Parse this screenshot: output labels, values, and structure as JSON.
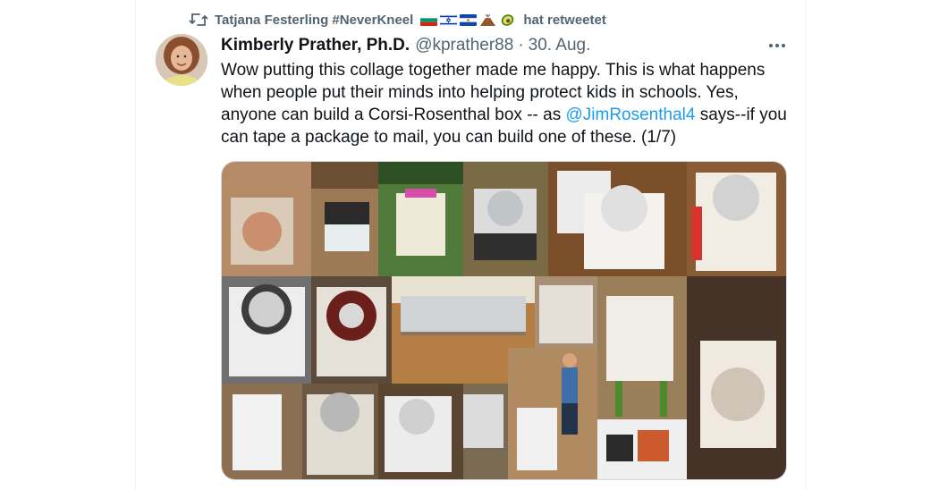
{
  "retweet": {
    "icon": "retweet-icon",
    "retweeter_name": "Tatjana Festerling #NeverKneel",
    "flags": [
      "bulgaria-flag",
      "israel-flag",
      "el-salvador-flag",
      "volcano-emoji",
      "avocado-emoji"
    ],
    "action_text": "hat retweetet"
  },
  "tweet": {
    "avatar_icon": "avatar-photo",
    "author_name": "Kimberly Prather, Ph.D.",
    "handle": "@kprather88",
    "separator": "·",
    "date": "30. Aug.",
    "more_icon": "more-options-icon",
    "text_part1": "Wow putting this collage together made me happy. This is what happens when people put their minds into helping protect kids in schools.  Yes, anyone can build a Corsi-Rosenthal box -- as ",
    "mention": "@JimRosenthal4",
    "text_part2": " says--if you can tape a package to mail, you can build one of these. (1/7)",
    "media_icon": "photo-collage-image"
  },
  "colors": {
    "text": "#0f1419",
    "secondary": "#536471",
    "link": "#1d9bf0",
    "border": "#cfd9de"
  }
}
